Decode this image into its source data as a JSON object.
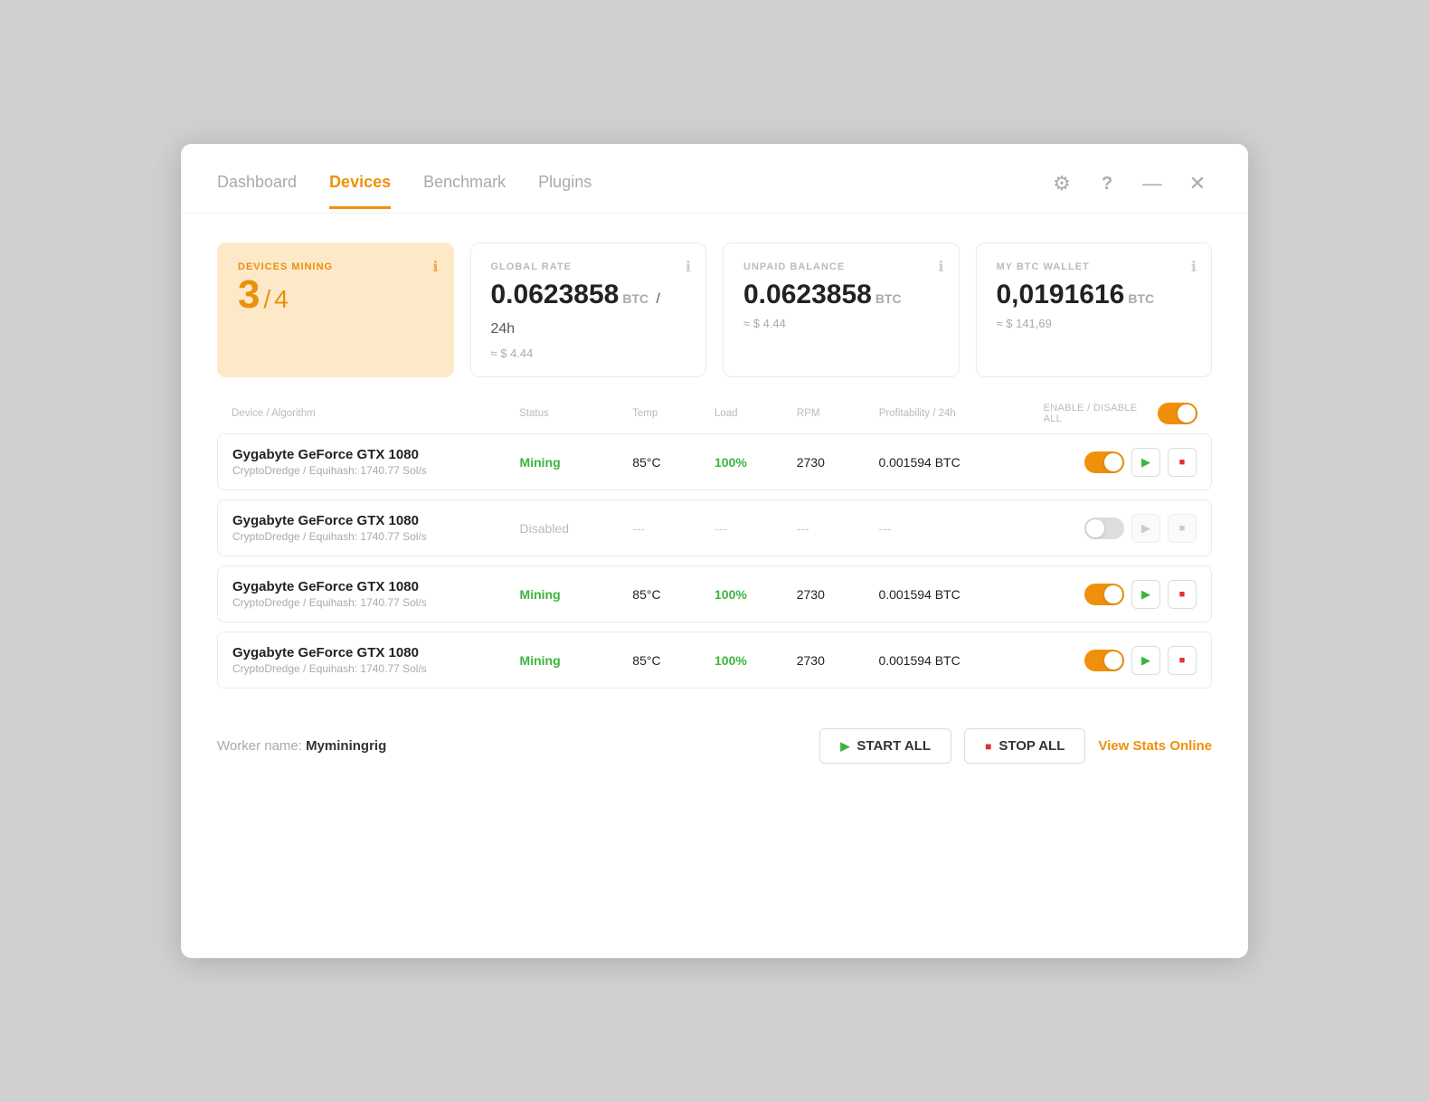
{
  "nav": {
    "tabs": [
      {
        "id": "dashboard",
        "label": "Dashboard",
        "active": false
      },
      {
        "id": "devices",
        "label": "Devices",
        "active": true
      },
      {
        "id": "benchmark",
        "label": "Benchmark",
        "active": false
      },
      {
        "id": "plugins",
        "label": "Plugins",
        "active": false
      }
    ]
  },
  "stats": {
    "devicesMining": {
      "label": "DEVICES MINING",
      "current": "3",
      "total": "4"
    },
    "globalRate": {
      "label": "GLOBAL RATE",
      "value": "0.0623858",
      "unit": "BTC",
      "period": "/ 24h",
      "sub": "≈ $ 4.44"
    },
    "unpaidBalance": {
      "label": "UNPAID BALANCE",
      "value": "0.0623858",
      "unit": "BTC",
      "sub": "≈ $ 4.44"
    },
    "btcWallet": {
      "label": "MY BTC WALLET",
      "value": "0,0191616",
      "unit": "BTC",
      "sub": "≈ $ 141,69"
    }
  },
  "table": {
    "headers": {
      "device": "Device / Algorithm",
      "status": "Status",
      "temp": "Temp",
      "load": "Load",
      "rpm": "RPM",
      "profit": "Profitability / 24h",
      "enableDisable": "ENABLE / DISABLE ALL"
    },
    "rows": [
      {
        "id": 1,
        "name": "Gygabyte GeForce GTX 1080",
        "algo": "CryptoDredge / Equihash: 1740.77 Sol/s",
        "status": "Mining",
        "statusType": "mining",
        "temp": "85°C",
        "load": "100%",
        "rpm": "2730",
        "profit": "0.001594 BTC",
        "enabled": true
      },
      {
        "id": 2,
        "name": "Gygabyte GeForce GTX 1080",
        "algo": "CryptoDredge / Equihash: 1740.77 Sol/s",
        "status": "Disabled",
        "statusType": "disabled",
        "temp": "---",
        "load": "---",
        "rpm": "---",
        "profit": "---",
        "enabled": false
      },
      {
        "id": 3,
        "name": "Gygabyte GeForce GTX 1080",
        "algo": "CryptoDredge / Equihash: 1740.77 Sol/s",
        "status": "Mining",
        "statusType": "mining",
        "temp": "85°C",
        "load": "100%",
        "rpm": "2730",
        "profit": "0.001594 BTC",
        "enabled": true
      },
      {
        "id": 4,
        "name": "Gygabyte GeForce GTX 1080",
        "algo": "CryptoDredge / Equihash: 1740.77 Sol/s",
        "status": "Mining",
        "statusType": "mining",
        "temp": "85°C",
        "load": "100%",
        "rpm": "2730",
        "profit": "0.001594 BTC",
        "enabled": true
      }
    ]
  },
  "footer": {
    "workerLabel": "Worker name:",
    "workerName": "Myminingrig",
    "startAllLabel": "START ALL",
    "stopAllLabel": "STOP ALL",
    "viewStatsLabel": "View Stats Online"
  },
  "icons": {
    "gear": "⚙",
    "help": "?",
    "minimize": "—",
    "close": "✕",
    "info": "ℹ"
  }
}
